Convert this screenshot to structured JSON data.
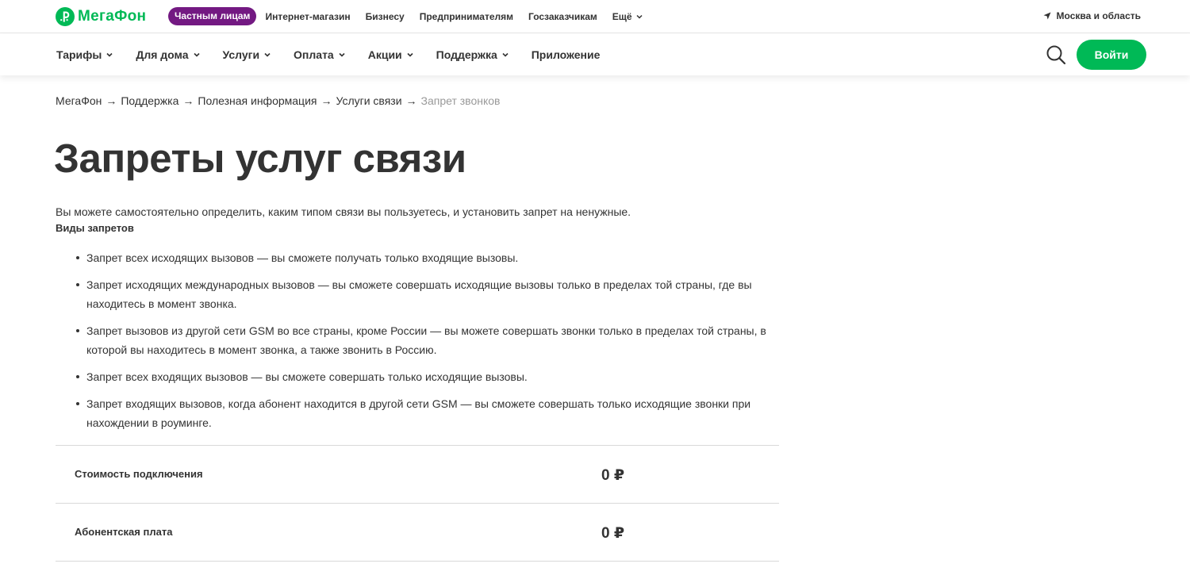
{
  "colors": {
    "brand_green": "#00b956",
    "segment_purple": "#731982",
    "text": "#333333",
    "muted": "#999999"
  },
  "logo": {
    "text": "МегаФон",
    "icon": "megafon-logo-icon"
  },
  "top_bar": {
    "segment_active": "Частным лицам",
    "links": [
      "Интернет-магазин",
      "Бизнесу",
      "Предпринимателям",
      "Госзаказчикам"
    ],
    "more_label": "Ещё",
    "region": "Москва и область"
  },
  "main_nav": {
    "items": [
      {
        "label": "Тарифы",
        "dropdown": true
      },
      {
        "label": "Для дома",
        "dropdown": true
      },
      {
        "label": "Услуги",
        "dropdown": true
      },
      {
        "label": "Оплата",
        "dropdown": true
      },
      {
        "label": "Акции",
        "dropdown": true
      },
      {
        "label": "Поддержка",
        "dropdown": true
      },
      {
        "label": "Приложение",
        "dropdown": false
      }
    ],
    "search_icon": "search-icon",
    "login_label": "Войти"
  },
  "breadcrumb": {
    "items": [
      "МегаФон",
      "Поддержка",
      "Полезная информация",
      "Услуги связи"
    ],
    "current": "Запрет звонков",
    "separator": "→"
  },
  "page": {
    "title": "Запреты услуг связи",
    "intro": "Вы можете самостоятельно определить, каким типом связи вы пользуетесь, и установить запрет на ненужные.",
    "subheading": "Виды запретов",
    "bans": [
      "Запрет всех исходящих вызовов — вы сможете получать только входящие вызовы.",
      "Запрет исходящих международных вызовов — вы сможете совершать исходящие вызовы только в пределах той страны, где вы находитесь в момент звонка.",
      "Запрет вызовов из другой сети GSM во все страны, кроме России — вы можете совершать звонки только в пределах той страны, в которой вы находитесь в момент звонка, а также звонить в Россию.",
      "Запрет всех входящих вызовов — вы сможете совершать только исходящие вызовы.",
      "Запрет входящих вызовов, когда абонент находится в другой сети GSM — вы сможете совершать только исходящие звонки при нахождении в роуминге."
    ],
    "prices": [
      {
        "label": "Стоимость подключения",
        "value": "0 ₽"
      },
      {
        "label": "Абонентская плата",
        "value": "0 ₽"
      }
    ]
  }
}
